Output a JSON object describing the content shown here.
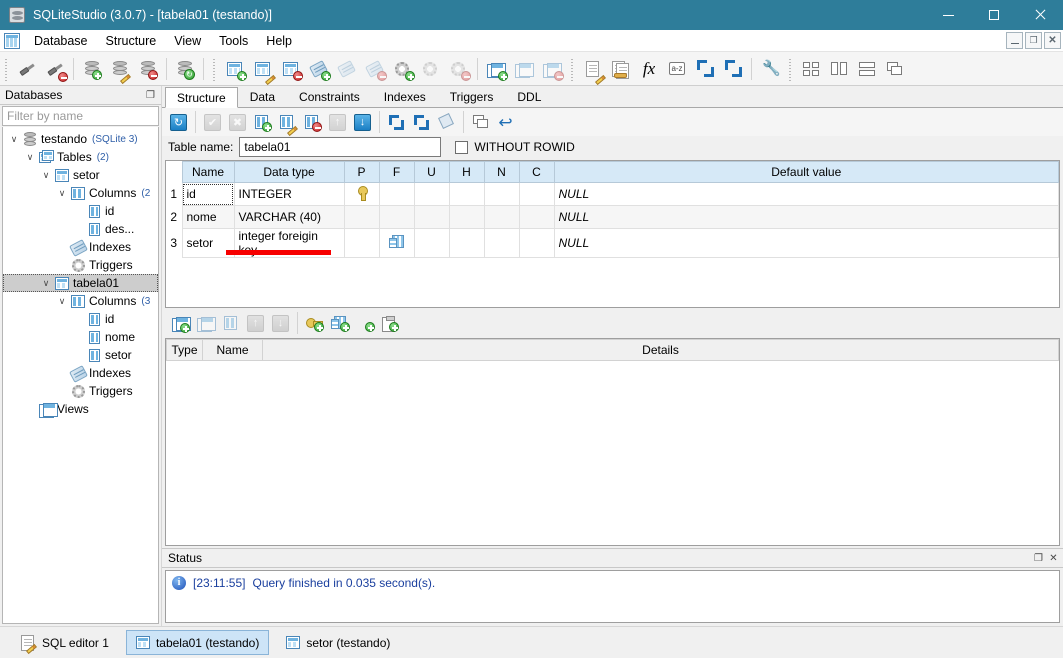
{
  "window": {
    "title": "SQLiteStudio (3.0.7) - [tabela01 (testando)]",
    "app_icon": "database-icon",
    "minimize": "–",
    "maximize": "□",
    "close": "×"
  },
  "menubar": {
    "icon": "table-icon",
    "items": [
      {
        "label": "Database"
      },
      {
        "label": "Structure"
      },
      {
        "label": "View"
      },
      {
        "label": "Tools"
      },
      {
        "label": "Help"
      }
    ],
    "mdi": {
      "minimize": "–",
      "restore": "❐",
      "close": "✕"
    }
  },
  "toolbar": {
    "groups": [
      {
        "items": [
          {
            "name": "connect-database-icon",
            "title": "Connect to the database"
          },
          {
            "name": "disconnect-database-icon",
            "title": "Disconnect from the database"
          }
        ]
      },
      {
        "items": [
          {
            "name": "add-database-icon",
            "title": "Add a database"
          },
          {
            "name": "edit-database-icon",
            "title": "Edit the database"
          },
          {
            "name": "remove-database-icon",
            "title": "Remove the database"
          }
        ]
      },
      {
        "items": [
          {
            "name": "refresh-schema-icon",
            "title": "Refresh schema"
          }
        ]
      },
      {
        "items": [
          {
            "name": "create-table-icon",
            "title": "Create a table"
          },
          {
            "name": "edit-table-icon",
            "title": "Edit the table"
          },
          {
            "name": "delete-table-icon",
            "title": "Delete the table"
          }
        ]
      },
      {
        "items": [
          {
            "name": "create-index-icon",
            "title": "Create an index"
          },
          {
            "name": "edit-index-icon",
            "title": "Edit the index"
          },
          {
            "name": "delete-index-icon",
            "title": "Delete the index"
          }
        ]
      },
      {
        "items": [
          {
            "name": "create-trigger-icon",
            "title": "Create a trigger"
          },
          {
            "name": "edit-trigger-icon",
            "title": "Edit the trigger"
          },
          {
            "name": "delete-trigger-icon",
            "title": "Delete the trigger"
          }
        ]
      },
      {
        "items": [
          {
            "name": "create-view-icon",
            "title": "Create a view"
          },
          {
            "name": "edit-view-icon",
            "title": "Edit the view"
          },
          {
            "name": "delete-view-icon",
            "title": "Delete the view"
          }
        ]
      },
      {
        "items": [
          {
            "name": "open-sql-editor-icon",
            "title": "Open SQL editor"
          },
          {
            "name": "sql-history-icon",
            "title": "SQL history"
          },
          {
            "name": "custom-sql-functions-icon",
            "title": "Custom SQL functions",
            "glyph": "fx"
          },
          {
            "name": "collations-editor-icon",
            "title": "Collations editor",
            "glyph": "a-z"
          },
          {
            "name": "collapse-all-icon",
            "title": "Collapse all"
          },
          {
            "name": "expand-all-icon",
            "title": "Expand all"
          }
        ]
      },
      {
        "items": [
          {
            "name": "open-configuration-icon",
            "title": "Open configuration dialog"
          }
        ]
      },
      {
        "items": [
          {
            "name": "tile-windows-icon",
            "title": "Tile windows"
          },
          {
            "name": "tile-vertically-icon",
            "title": "Tile windows vertically"
          },
          {
            "name": "tile-horizontally-icon",
            "title": "Tile windows horizontally"
          },
          {
            "name": "cascade-windows-icon",
            "title": "Cascade windows"
          }
        ]
      }
    ]
  },
  "databases_dock": {
    "title": "Databases",
    "float_glyph": "❐",
    "filter_placeholder": "Filter by name",
    "tree": [
      {
        "label": "testando",
        "badge": "(SQLite 3)",
        "icon": "database-icon",
        "indent": 0,
        "expanded": true,
        "selected": false
      },
      {
        "label": "Tables",
        "badge": "(2)",
        "icon": "tables-icon",
        "indent": 1,
        "expanded": true,
        "selected": false
      },
      {
        "label": "setor",
        "badge": "",
        "icon": "table-icon",
        "indent": 2,
        "expanded": true,
        "selected": false
      },
      {
        "label": "Columns",
        "badge": "(2",
        "icon": "columns-icon",
        "indent": 3,
        "expanded": true,
        "selected": false
      },
      {
        "label": "id",
        "badge": "",
        "icon": "column-icon",
        "indent": 4,
        "expanded": null,
        "selected": false
      },
      {
        "label": "des...",
        "badge": "",
        "icon": "column-icon",
        "indent": 4,
        "expanded": null,
        "selected": false
      },
      {
        "label": "Indexes",
        "badge": "",
        "icon": "index-icon",
        "indent": 3,
        "expanded": null,
        "selected": false
      },
      {
        "label": "Triggers",
        "badge": "",
        "icon": "trigger-icon",
        "indent": 3,
        "expanded": null,
        "selected": false
      },
      {
        "label": "tabela01",
        "badge": "",
        "icon": "table-icon",
        "indent": 2,
        "expanded": true,
        "selected": true
      },
      {
        "label": "Columns",
        "badge": "(3",
        "icon": "columns-icon",
        "indent": 3,
        "expanded": true,
        "selected": false
      },
      {
        "label": "id",
        "badge": "",
        "icon": "column-icon",
        "indent": 4,
        "expanded": null,
        "selected": false
      },
      {
        "label": "nome",
        "badge": "",
        "icon": "column-icon",
        "indent": 4,
        "expanded": null,
        "selected": false
      },
      {
        "label": "setor",
        "badge": "",
        "icon": "column-icon",
        "indent": 4,
        "expanded": null,
        "selected": false
      },
      {
        "label": "Indexes",
        "badge": "",
        "icon": "index-icon",
        "indent": 3,
        "expanded": null,
        "selected": false
      },
      {
        "label": "Triggers",
        "badge": "",
        "icon": "trigger-icon",
        "indent": 3,
        "expanded": null,
        "selected": false
      },
      {
        "label": "Views",
        "badge": "",
        "icon": "views-icon",
        "indent": 1,
        "expanded": null,
        "selected": false
      }
    ]
  },
  "editor": {
    "tabs": [
      {
        "label": "Structure",
        "active": true
      },
      {
        "label": "Data",
        "active": false
      },
      {
        "label": "Constraints",
        "active": false
      },
      {
        "label": "Indexes",
        "active": false
      },
      {
        "label": "Triggers",
        "active": false
      },
      {
        "label": "DDL",
        "active": false
      }
    ],
    "structure_toolbar": [
      {
        "name": "refresh-structure-button",
        "glyph": "↻",
        "state": "enabled",
        "style": "blue"
      },
      {
        "name": "commit-structure-button",
        "glyph": "✔",
        "state": "disabled",
        "style": "gray"
      },
      {
        "name": "rollback-structure-button",
        "glyph": "✖",
        "state": "disabled",
        "style": "gray"
      },
      {
        "name": "add-column-button",
        "glyph": "",
        "state": "enabled",
        "style": "icon-add-column"
      },
      {
        "name": "edit-column-button",
        "glyph": "",
        "state": "enabled",
        "style": "icon-edit-column"
      },
      {
        "name": "delete-column-button",
        "glyph": "",
        "state": "enabled",
        "style": "icon-del-column"
      },
      {
        "name": "move-column-up-button",
        "glyph": "↑",
        "state": "disabled",
        "style": "gray"
      },
      {
        "name": "move-column-down-button",
        "glyph": "↓",
        "state": "enabled",
        "style": "blue"
      },
      {
        "name": "collapse-columns-button",
        "glyph": "",
        "state": "enabled",
        "style": "icon-collapse"
      },
      {
        "name": "expand-columns-button",
        "glyph": "",
        "state": "enabled",
        "style": "icon-expand"
      },
      {
        "name": "table-color-button",
        "glyph": "",
        "state": "enabled",
        "style": "icon-fill"
      },
      {
        "name": "copy-table-button",
        "glyph": "",
        "state": "enabled",
        "style": "icon-copy"
      },
      {
        "name": "reset-autoincrement-button",
        "glyph": "↩",
        "state": "enabled",
        "style": "icon-undo"
      }
    ],
    "table_name_label": "Table name:",
    "table_name_value": "tabela01",
    "without_rowid_label": "WITHOUT ROWID",
    "without_rowid_checked": false,
    "columns_grid": {
      "headers": [
        "",
        "Name",
        "Data type",
        "P",
        "F",
        "U",
        "H",
        "N",
        "C",
        "Default value"
      ],
      "rows": [
        {
          "num": "1",
          "name": "id",
          "type": "INTEGER",
          "p": "key",
          "f": "",
          "u": "",
          "h": "",
          "n": "",
          "c": "",
          "default": "NULL"
        },
        {
          "num": "2",
          "name": "nome",
          "type": "VARCHAR (40)",
          "p": "",
          "f": "",
          "u": "",
          "h": "",
          "n": "",
          "c": "",
          "default": "NULL"
        },
        {
          "num": "3",
          "name": "setor",
          "type": "integer foreigin key",
          "p": "",
          "f": "fk",
          "u": "",
          "h": "",
          "n": "",
          "c": "",
          "default": "NULL"
        }
      ]
    },
    "constraints_toolbar": [
      {
        "name": "add-constraint-button",
        "state": "enabled",
        "style": "icon-add-constraint"
      },
      {
        "name": "edit-constraint-button",
        "state": "disabled",
        "style": "icon-edit-constraint"
      },
      {
        "name": "delete-constraint-button",
        "state": "disabled",
        "style": "icon-del-constraint"
      },
      {
        "name": "move-constraint-up-button",
        "glyph": "↑",
        "state": "disabled",
        "style": "gray"
      },
      {
        "name": "move-constraint-down-button",
        "glyph": "↓",
        "state": "disabled",
        "style": "gray"
      },
      {
        "name": "add-primary-key-button",
        "state": "enabled",
        "style": "icon-pk"
      },
      {
        "name": "add-foreign-key-button",
        "state": "enabled",
        "style": "icon-fk"
      },
      {
        "name": "add-unique-button",
        "state": "enabled",
        "style": "icon-unique"
      },
      {
        "name": "add-check-button",
        "state": "enabled",
        "style": "icon-check"
      }
    ],
    "constraints_grid": {
      "headers": [
        "Type",
        "Name",
        "Details"
      ],
      "rows": []
    }
  },
  "status_dock": {
    "title": "Status",
    "float_glyph": "❐",
    "close_glyph": "✕",
    "messages": [
      {
        "icon": "info-icon",
        "time": "[23:11:55]",
        "text": "Query finished in 0.035 second(s)."
      }
    ]
  },
  "taskbar": {
    "items": [
      {
        "label": "SQL editor 1",
        "icon": "sql-editor-icon",
        "active": false
      },
      {
        "label": "tabela01 (testando)",
        "icon": "table-icon",
        "active": true
      },
      {
        "label": "setor (testando)",
        "icon": "table-icon",
        "active": false
      }
    ]
  },
  "annotation": {
    "type": "red-underline",
    "color": "#f70000",
    "target": "integer foreigin key"
  }
}
